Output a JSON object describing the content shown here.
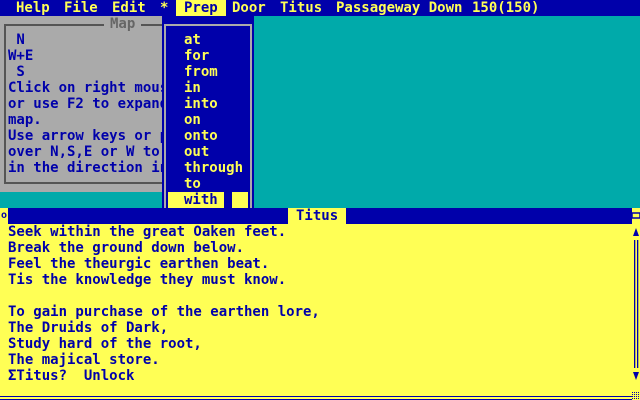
{
  "menubar": {
    "items": [
      "Help",
      "File",
      "Edit",
      "*",
      "Prep",
      "Door",
      "Titus",
      "Passageway Down",
      "150(150)"
    ],
    "active": "Prep"
  },
  "map": {
    "title": "Map",
    "lines": [
      " N",
      "W+E",
      " S",
      "Click on right mous",
      "or use F2 to expand",
      "map.",
      "Use arrow keys or p",
      "over N,S,E or W to",
      "in the direction in"
    ]
  },
  "prep_menu": {
    "options": [
      "at",
      "for",
      "from",
      "in",
      "into",
      "on",
      "onto",
      "out",
      "through",
      "to",
      "with"
    ],
    "selected": "with"
  },
  "window": {
    "title": "Titus",
    "lines": [
      "Seek within the great Oaken feet.",
      "Break the ground down below.",
      "Feel the theurgic earthen beat.",
      "Tis the knowledge they must know.",
      "",
      "To gain purchase of the earthen lore,",
      "The Druids of Dark,",
      "Study hard of the root,",
      "The majical store.",
      "ΣTitus?  Unlock"
    ]
  },
  "colors": {
    "blue": "#0000aa",
    "yellow": "#ffff55",
    "teal": "#00aaaa",
    "gray": "#aaaaaa"
  }
}
